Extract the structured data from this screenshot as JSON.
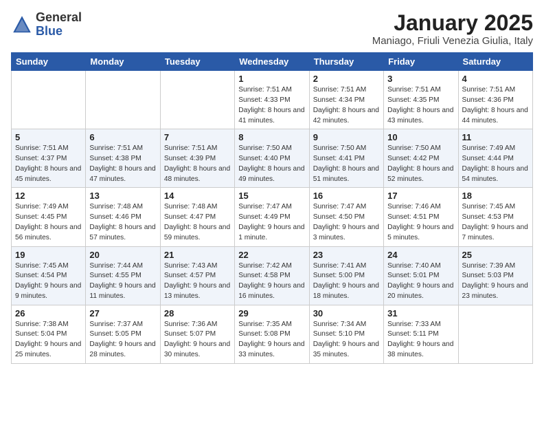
{
  "header": {
    "logo_general": "General",
    "logo_blue": "Blue",
    "month_title": "January 2025",
    "subtitle": "Maniago, Friuli Venezia Giulia, Italy"
  },
  "weekdays": [
    "Sunday",
    "Monday",
    "Tuesday",
    "Wednesday",
    "Thursday",
    "Friday",
    "Saturday"
  ],
  "weeks": [
    [
      {
        "day": "",
        "info": ""
      },
      {
        "day": "",
        "info": ""
      },
      {
        "day": "",
        "info": ""
      },
      {
        "day": "1",
        "info": "Sunrise: 7:51 AM\nSunset: 4:33 PM\nDaylight: 8 hours\nand 41 minutes."
      },
      {
        "day": "2",
        "info": "Sunrise: 7:51 AM\nSunset: 4:34 PM\nDaylight: 8 hours\nand 42 minutes."
      },
      {
        "day": "3",
        "info": "Sunrise: 7:51 AM\nSunset: 4:35 PM\nDaylight: 8 hours\nand 43 minutes."
      },
      {
        "day": "4",
        "info": "Sunrise: 7:51 AM\nSunset: 4:36 PM\nDaylight: 8 hours\nand 44 minutes."
      }
    ],
    [
      {
        "day": "5",
        "info": "Sunrise: 7:51 AM\nSunset: 4:37 PM\nDaylight: 8 hours\nand 45 minutes."
      },
      {
        "day": "6",
        "info": "Sunrise: 7:51 AM\nSunset: 4:38 PM\nDaylight: 8 hours\nand 47 minutes."
      },
      {
        "day": "7",
        "info": "Sunrise: 7:51 AM\nSunset: 4:39 PM\nDaylight: 8 hours\nand 48 minutes."
      },
      {
        "day": "8",
        "info": "Sunrise: 7:50 AM\nSunset: 4:40 PM\nDaylight: 8 hours\nand 49 minutes."
      },
      {
        "day": "9",
        "info": "Sunrise: 7:50 AM\nSunset: 4:41 PM\nDaylight: 8 hours\nand 51 minutes."
      },
      {
        "day": "10",
        "info": "Sunrise: 7:50 AM\nSunset: 4:42 PM\nDaylight: 8 hours\nand 52 minutes."
      },
      {
        "day": "11",
        "info": "Sunrise: 7:49 AM\nSunset: 4:44 PM\nDaylight: 8 hours\nand 54 minutes."
      }
    ],
    [
      {
        "day": "12",
        "info": "Sunrise: 7:49 AM\nSunset: 4:45 PM\nDaylight: 8 hours\nand 56 minutes."
      },
      {
        "day": "13",
        "info": "Sunrise: 7:48 AM\nSunset: 4:46 PM\nDaylight: 8 hours\nand 57 minutes."
      },
      {
        "day": "14",
        "info": "Sunrise: 7:48 AM\nSunset: 4:47 PM\nDaylight: 8 hours\nand 59 minutes."
      },
      {
        "day": "15",
        "info": "Sunrise: 7:47 AM\nSunset: 4:49 PM\nDaylight: 9 hours\nand 1 minute."
      },
      {
        "day": "16",
        "info": "Sunrise: 7:47 AM\nSunset: 4:50 PM\nDaylight: 9 hours\nand 3 minutes."
      },
      {
        "day": "17",
        "info": "Sunrise: 7:46 AM\nSunset: 4:51 PM\nDaylight: 9 hours\nand 5 minutes."
      },
      {
        "day": "18",
        "info": "Sunrise: 7:45 AM\nSunset: 4:53 PM\nDaylight: 9 hours\nand 7 minutes."
      }
    ],
    [
      {
        "day": "19",
        "info": "Sunrise: 7:45 AM\nSunset: 4:54 PM\nDaylight: 9 hours\nand 9 minutes."
      },
      {
        "day": "20",
        "info": "Sunrise: 7:44 AM\nSunset: 4:55 PM\nDaylight: 9 hours\nand 11 minutes."
      },
      {
        "day": "21",
        "info": "Sunrise: 7:43 AM\nSunset: 4:57 PM\nDaylight: 9 hours\nand 13 minutes."
      },
      {
        "day": "22",
        "info": "Sunrise: 7:42 AM\nSunset: 4:58 PM\nDaylight: 9 hours\nand 16 minutes."
      },
      {
        "day": "23",
        "info": "Sunrise: 7:41 AM\nSunset: 5:00 PM\nDaylight: 9 hours\nand 18 minutes."
      },
      {
        "day": "24",
        "info": "Sunrise: 7:40 AM\nSunset: 5:01 PM\nDaylight: 9 hours\nand 20 minutes."
      },
      {
        "day": "25",
        "info": "Sunrise: 7:39 AM\nSunset: 5:03 PM\nDaylight: 9 hours\nand 23 minutes."
      }
    ],
    [
      {
        "day": "26",
        "info": "Sunrise: 7:38 AM\nSunset: 5:04 PM\nDaylight: 9 hours\nand 25 minutes."
      },
      {
        "day": "27",
        "info": "Sunrise: 7:37 AM\nSunset: 5:05 PM\nDaylight: 9 hours\nand 28 minutes."
      },
      {
        "day": "28",
        "info": "Sunrise: 7:36 AM\nSunset: 5:07 PM\nDaylight: 9 hours\nand 30 minutes."
      },
      {
        "day": "29",
        "info": "Sunrise: 7:35 AM\nSunset: 5:08 PM\nDaylight: 9 hours\nand 33 minutes."
      },
      {
        "day": "30",
        "info": "Sunrise: 7:34 AM\nSunset: 5:10 PM\nDaylight: 9 hours\nand 35 minutes."
      },
      {
        "day": "31",
        "info": "Sunrise: 7:33 AM\nSunset: 5:11 PM\nDaylight: 9 hours\nand 38 minutes."
      },
      {
        "day": "",
        "info": ""
      }
    ]
  ]
}
